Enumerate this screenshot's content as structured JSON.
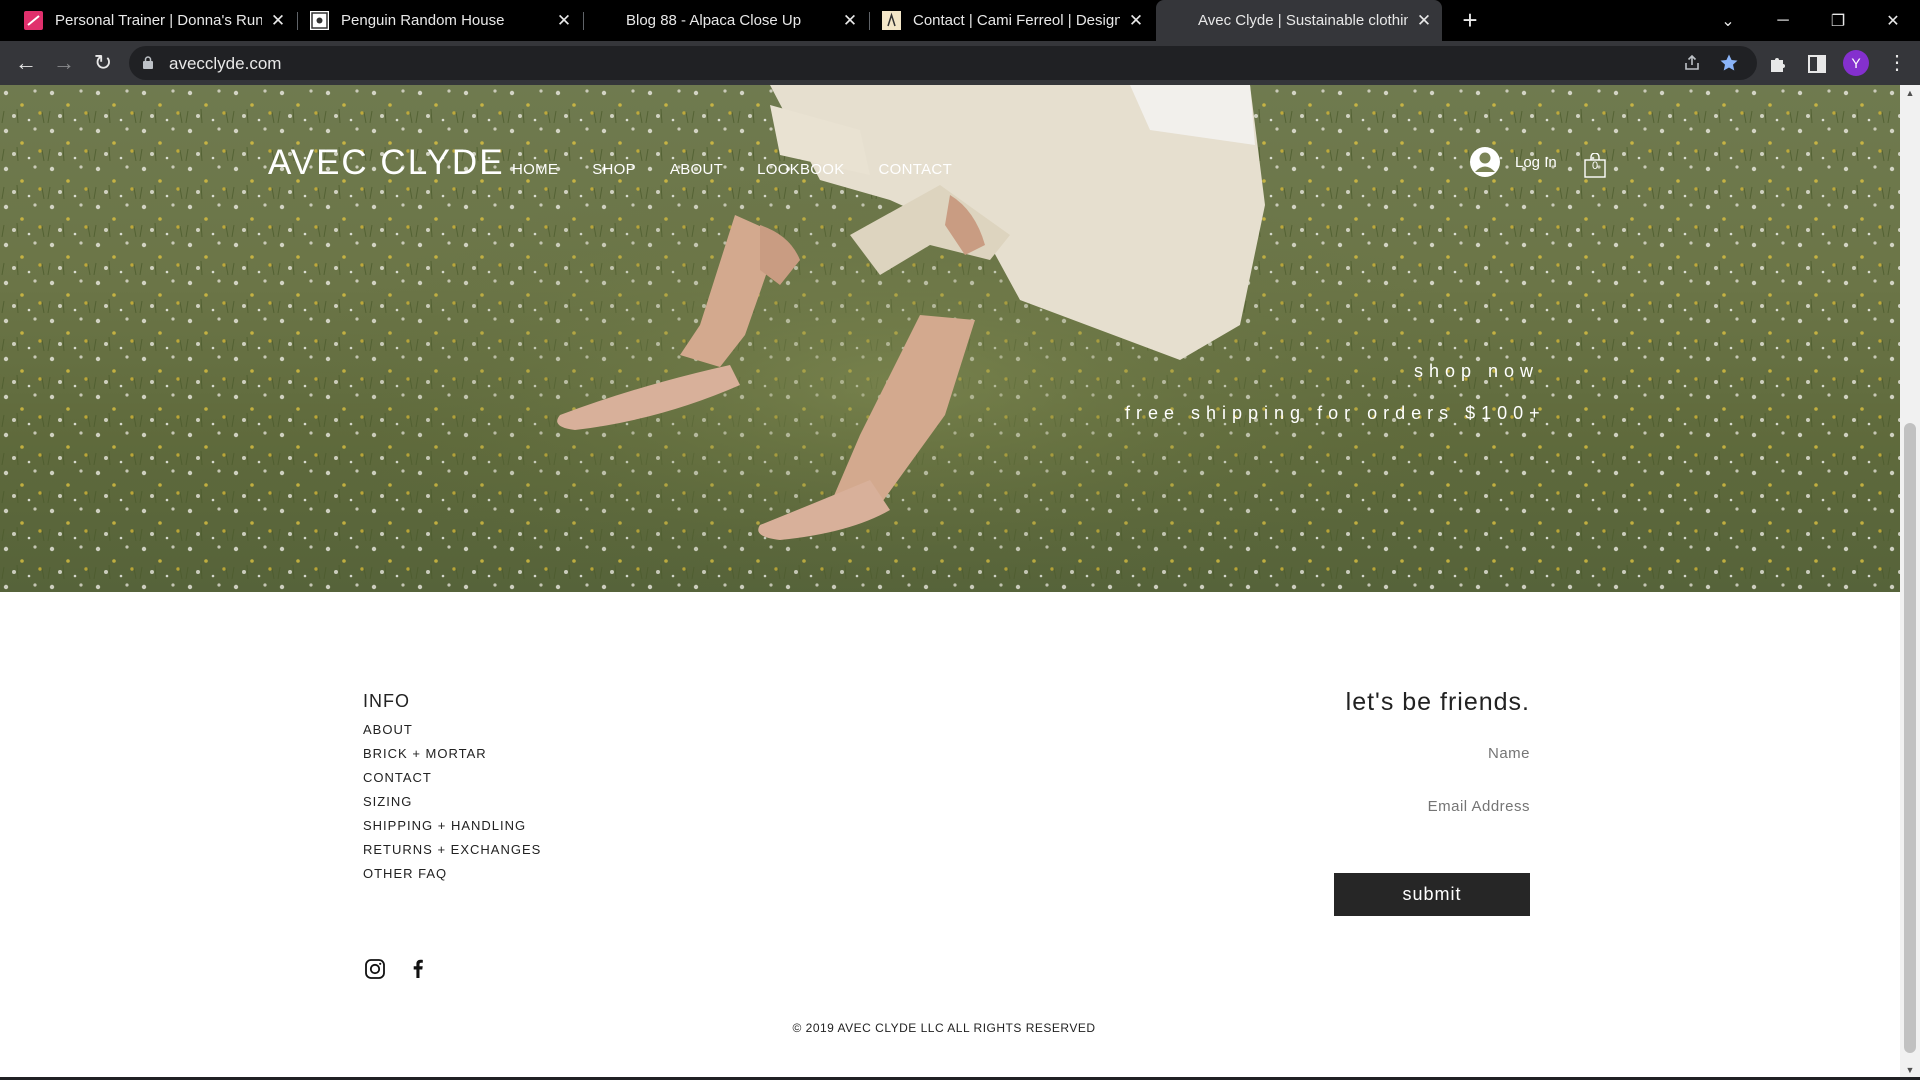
{
  "browser": {
    "tabs": [
      {
        "title": "Personal Trainer | Donna's Runnin",
        "icon": "pink-favicon",
        "active": false
      },
      {
        "title": "Penguin Random House",
        "icon": "penguin-favicon",
        "active": false
      },
      {
        "title": "Blog 88 - Alpaca Close Up",
        "icon": "none",
        "active": false
      },
      {
        "title": "Contact | Cami Ferreol | Designer",
        "icon": "cami-favicon",
        "active": false
      },
      {
        "title": "Avec Clyde | Sustainable clothing",
        "icon": "none",
        "active": true
      }
    ],
    "new_tab": "+",
    "url": "avecclyde.com",
    "profile_initial": "Y",
    "colors": {
      "tabbar": "#000000",
      "toolbar": "#35363a",
      "omnibox": "#202124",
      "avatar": "#8430ce",
      "bookmark_star": "#8ab4f8"
    }
  },
  "site": {
    "brand": "AVEC CLYDE",
    "nav": [
      "HOME",
      "SHOP",
      "ABOUT",
      "LOOKBOOK",
      "CONTACT"
    ],
    "login_label": "Log In",
    "cart_count": "0",
    "hero": {
      "shop_now": "shop now",
      "free_shipping": "free shipping for orders $100+"
    },
    "footer": {
      "info_title": "INFO",
      "info_links": [
        "ABOUT",
        "BRICK + MORTAR",
        "CONTACT",
        "SIZING",
        "SHIPPING + HANDLING",
        "RETURNS + EXCHANGES",
        "OTHER FAQ"
      ],
      "newsletter_title": "let's be friends.",
      "name_placeholder": "Name",
      "email_placeholder": "Email Address",
      "submit_label": "submit",
      "social": [
        "instagram-icon",
        "facebook-icon"
      ],
      "copyright": "© 2019 AVEC CLYDE LLC ALL RIGHTS RESERVED"
    },
    "colors": {
      "button": "#262626",
      "text": "#222222"
    }
  }
}
